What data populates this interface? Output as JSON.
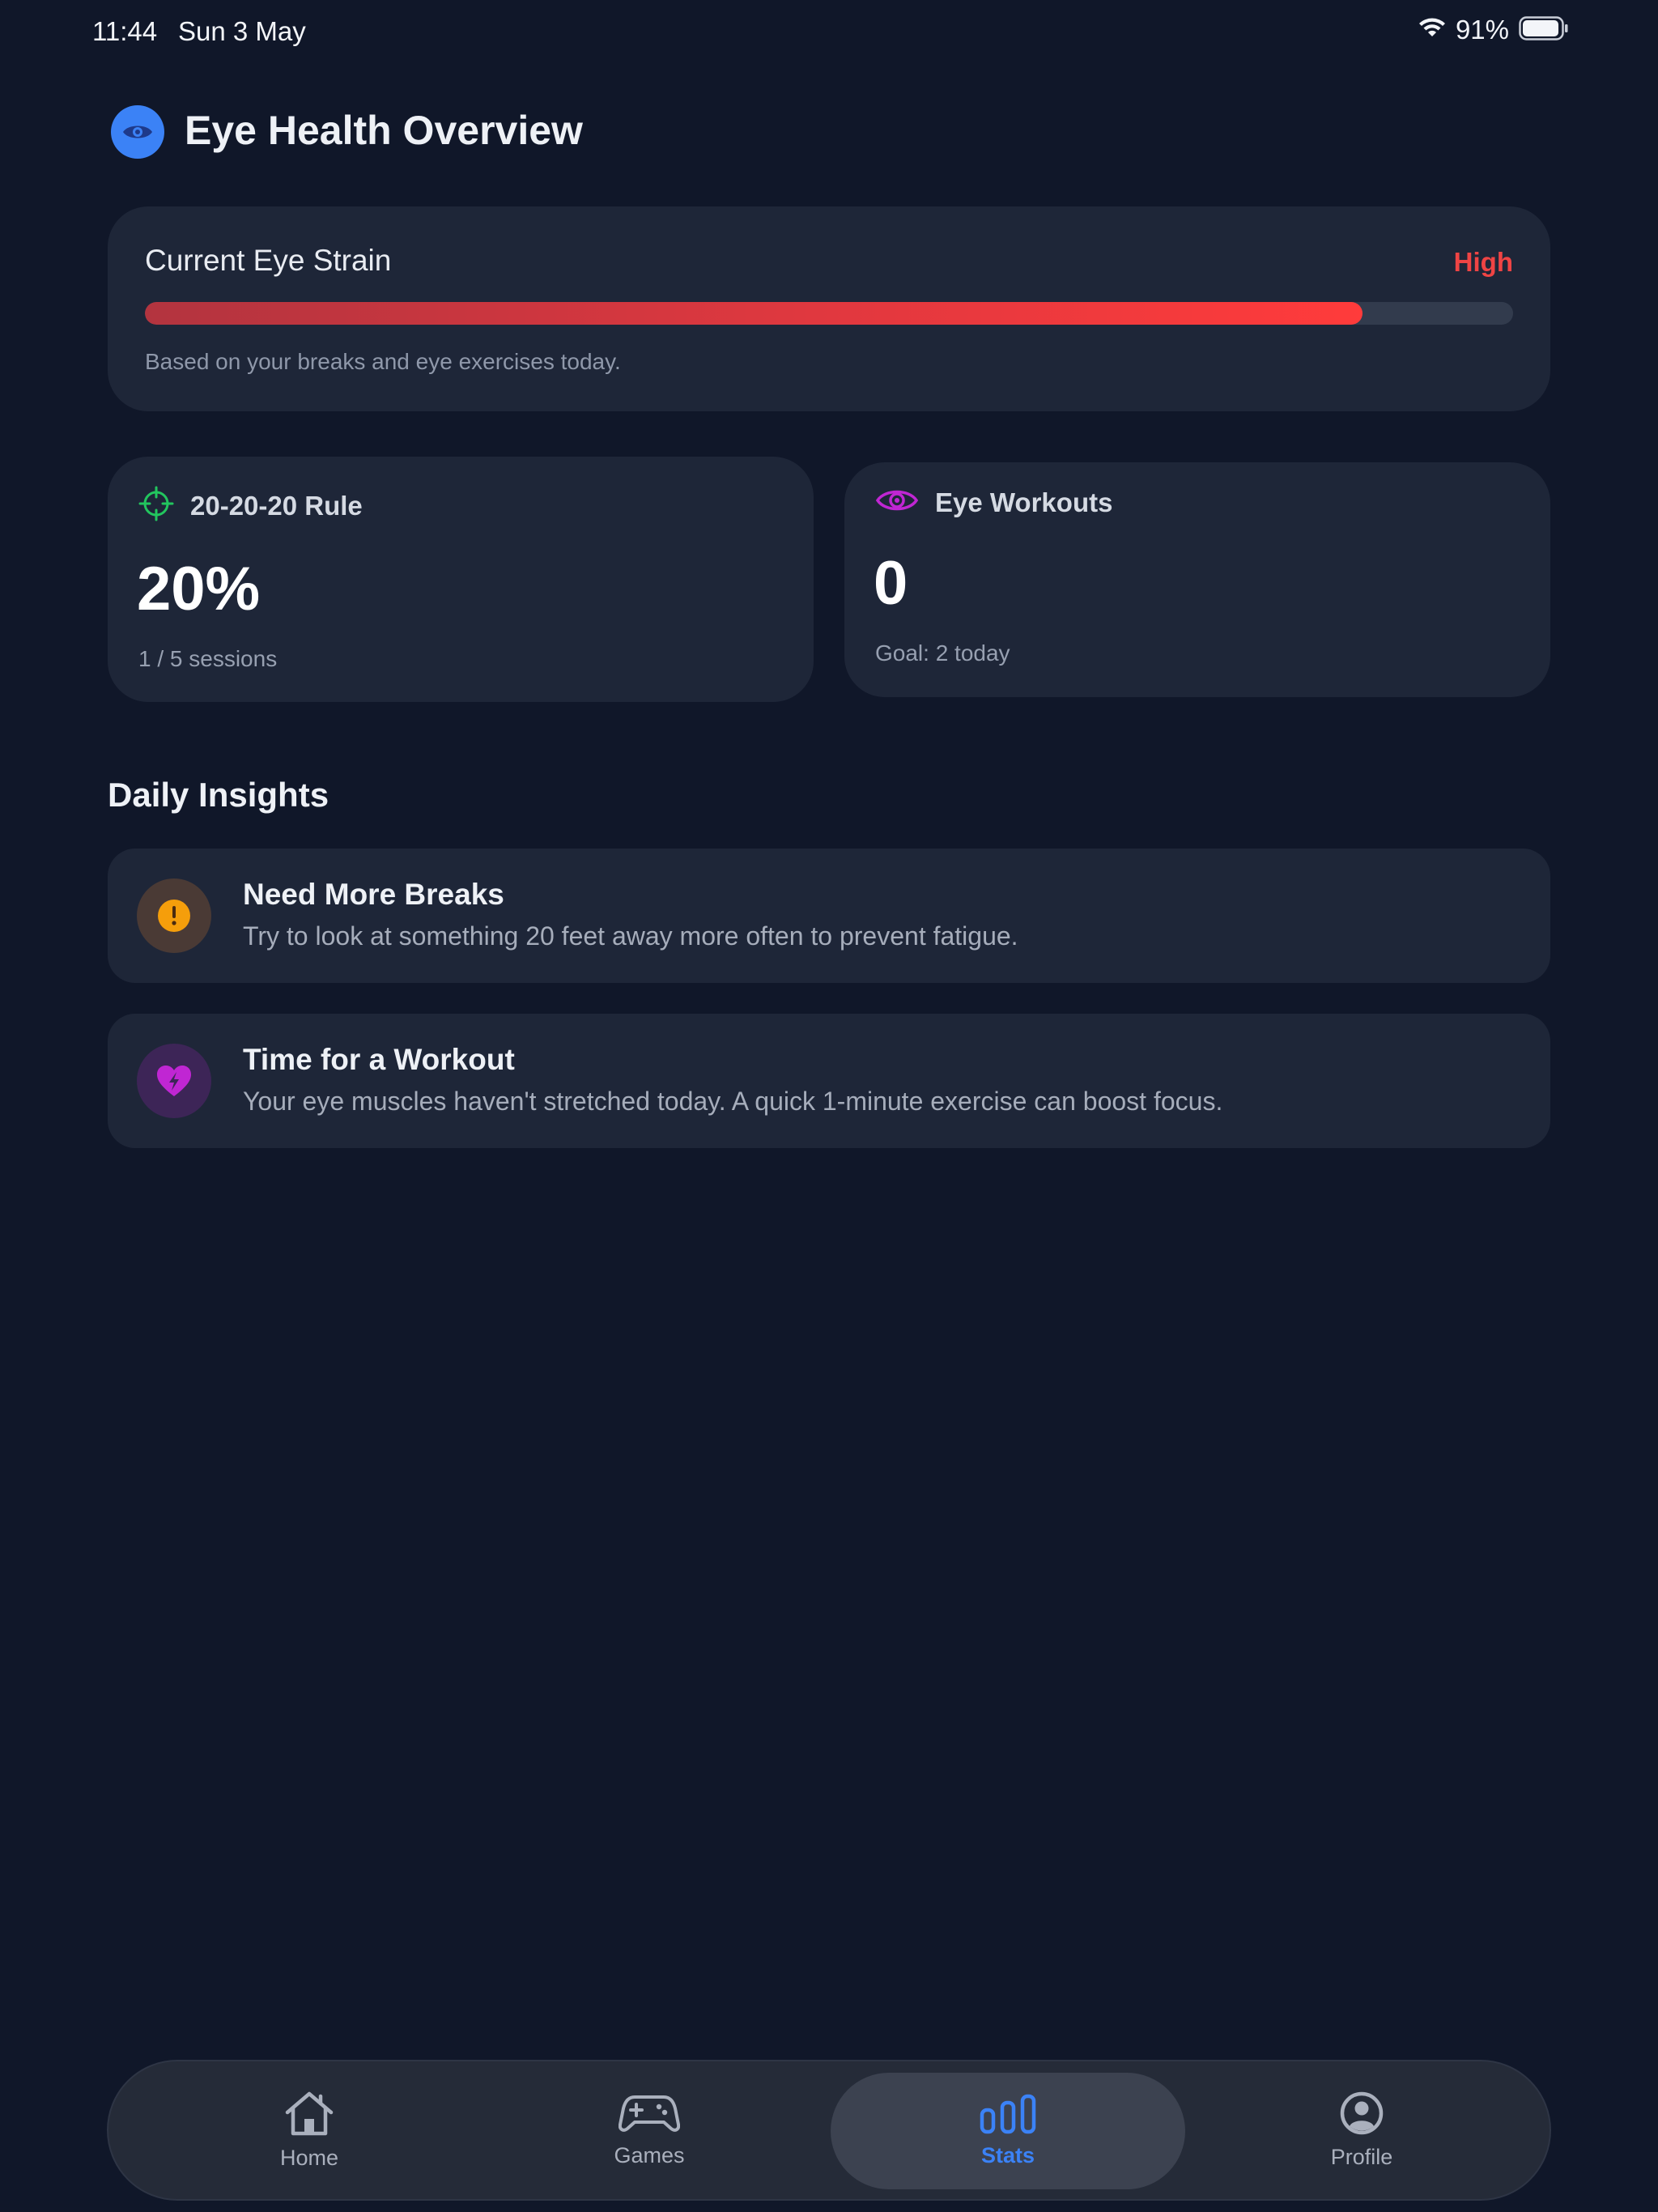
{
  "status_bar": {
    "time": "11:44",
    "date": "Sun 3 May",
    "battery": "91%",
    "icons": [
      "wifi-icon",
      "battery-icon"
    ]
  },
  "header": {
    "title": "Eye Health Overview",
    "icon": "eye-icon"
  },
  "strain": {
    "title": "Current Eye Strain",
    "level": "High",
    "level_percent": 89,
    "note": "Based on your breaks and eye exercises today."
  },
  "stats": {
    "rule": {
      "icon": "crosshair-icon",
      "label": "20-20-20 Rule",
      "value": "20%",
      "sub": "1 / 5 sessions"
    },
    "workouts": {
      "icon": "eye-icon",
      "label": "Eye Workouts",
      "value": "0",
      "sub": "Goal: 2 today"
    }
  },
  "insights": {
    "title": "Daily Insights",
    "items": [
      {
        "icon": "alert-icon",
        "title": "Need More Breaks",
        "text": "Try to look at something 20 feet away more often to prevent fatigue."
      },
      {
        "icon": "heart-bolt-icon",
        "title": "Time for a Workout",
        "text": "Your eye muscles haven't stretched today. A quick 1-minute exercise can boost focus."
      }
    ]
  },
  "tabs": [
    {
      "label": "Home",
      "icon": "home-icon"
    },
    {
      "label": "Games",
      "icon": "gamepad-icon"
    },
    {
      "label": "Stats",
      "icon": "bar-chart-icon",
      "active": true
    },
    {
      "label": "Profile",
      "icon": "profile-icon"
    }
  ],
  "colors": {
    "background": "#101729",
    "card": "#1e2638",
    "accent": "#3b82f6",
    "danger": "#ef4444",
    "success": "#22c55e",
    "purple": "#c026d3",
    "orange": "#f59e0b"
  }
}
